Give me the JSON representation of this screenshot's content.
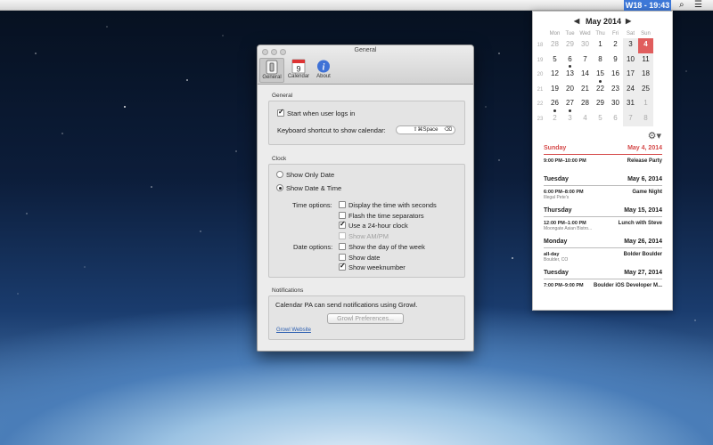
{
  "menubar": {
    "week_clock": "W18 - 19:43",
    "icons": [
      "search-icon",
      "list-icon"
    ]
  },
  "calendar": {
    "month_title": "May 2014",
    "weekday_headers": [
      "Mon",
      "Tue",
      "Wed",
      "Thu",
      "Fri",
      "Sat",
      "Sun"
    ],
    "weeks": [
      {
        "week": "18",
        "days": [
          "28",
          "29",
          "30",
          "1",
          "2",
          "3",
          "4"
        ]
      },
      {
        "week": "19",
        "days": [
          "5",
          "6",
          "7",
          "8",
          "9",
          "10",
          "11"
        ]
      },
      {
        "week": "20",
        "days": [
          "12",
          "13",
          "14",
          "15",
          "16",
          "17",
          "18"
        ]
      },
      {
        "week": "21",
        "days": [
          "19",
          "20",
          "21",
          "22",
          "23",
          "24",
          "25"
        ]
      },
      {
        "week": "22",
        "days": [
          "26",
          "27",
          "28",
          "29",
          "30",
          "31",
          "1"
        ]
      },
      {
        "week": "23",
        "days": [
          "2",
          "3",
          "4",
          "5",
          "6",
          "7",
          "8"
        ]
      }
    ],
    "today": "4",
    "events": [
      {
        "day": "Sunday",
        "date": "May 4, 2014",
        "items": [
          {
            "time": "9:00 PM–10:00 PM",
            "name": "Release Party",
            "location": ""
          }
        ]
      },
      {
        "day": "Tuesday",
        "date": "May 6, 2014",
        "items": [
          {
            "time": "6:00 PM–8:00 PM",
            "name": "Game Night",
            "location": "Illegal Pete's"
          }
        ]
      },
      {
        "day": "Thursday",
        "date": "May 15, 2014",
        "items": [
          {
            "time": "12:00 PM–1:00 PM",
            "name": "Lunch with Steve",
            "location": "Moongate Asian Bistro..."
          }
        ]
      },
      {
        "day": "Monday",
        "date": "May 26, 2014",
        "items": [
          {
            "time": "all-day",
            "name": "Bolder Boulder",
            "location": "Boulder, CO"
          }
        ]
      },
      {
        "day": "Tuesday",
        "date": "May 27, 2014",
        "items": [
          {
            "time": "7:00 PM–9:00 PM",
            "name": "Boulder iOS Developer M...",
            "location": ""
          }
        ]
      }
    ]
  },
  "prefs": {
    "window_title": "General",
    "toolbar": {
      "general": "General",
      "calendar": "Calendar",
      "calendar_icon_day": "9",
      "about": "About"
    },
    "general_section": {
      "label": "General",
      "start_login": "Start when user logs in",
      "start_login_checked": true,
      "shortcut_label": "Keyboard shortcut to show calendar:",
      "shortcut_value": "⇧⌘Space"
    },
    "clock_section": {
      "label": "Clock",
      "show_only_date": "Show Only Date",
      "show_date_time": "Show Date & Time",
      "time_options_label": "Time options:",
      "time_options": [
        {
          "label": "Display the time with seconds",
          "checked": false,
          "disabled": false
        },
        {
          "label": "Flash the time separators",
          "checked": false,
          "disabled": false
        },
        {
          "label": "Use a 24-hour clock",
          "checked": true,
          "disabled": false
        },
        {
          "label": "Show AM/PM",
          "checked": false,
          "disabled": true
        }
      ],
      "date_options_label": "Date options:",
      "date_options": [
        {
          "label": "Show the day of the week",
          "checked": false
        },
        {
          "label": "Show date",
          "checked": false
        },
        {
          "label": "Show weeknumber",
          "checked": true
        }
      ]
    },
    "notifications_section": {
      "label": "Notifications",
      "text": "Calendar PA can send notifications using Growl.",
      "button": "Growl Preferences...",
      "link": "Growl Website"
    }
  },
  "colors": {
    "accent_blue": "#3d78d8",
    "today_red": "#e05d5d",
    "link_blue": "#2a5db0"
  }
}
